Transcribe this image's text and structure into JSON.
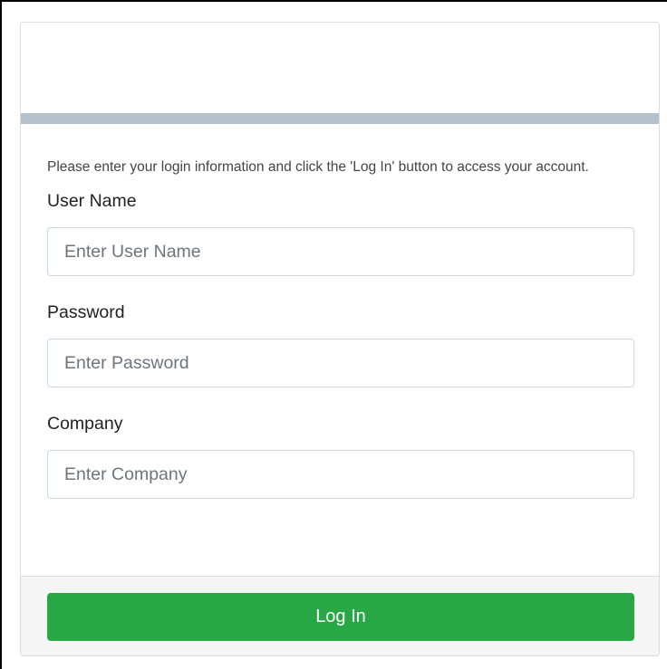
{
  "login_form": {
    "intro_text": "Please enter your login information and click the 'Log In' button to access your account.",
    "fields": [
      {
        "label": "User Name",
        "placeholder": "Enter User Name",
        "value": ""
      },
      {
        "label": "Password",
        "placeholder": "Enter Password",
        "value": ""
      },
      {
        "label": "Company",
        "placeholder": "Enter Company",
        "value": ""
      }
    ],
    "submit_label": "Log In"
  },
  "colors": {
    "header_bar": "#b4c2cd",
    "button_primary": "#28a745",
    "footer_background": "#f5f5f5"
  }
}
